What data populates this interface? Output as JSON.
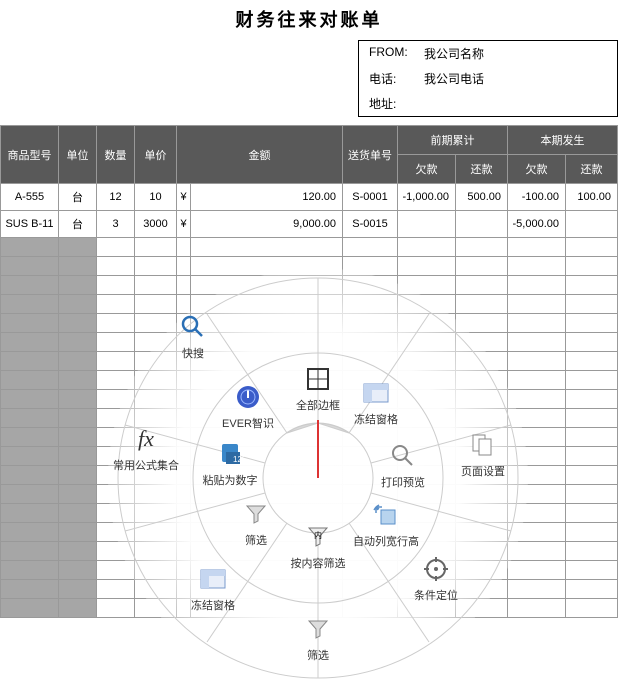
{
  "title": "财务往来对账单",
  "info": {
    "from_label": "FROM:",
    "from_val": "我公司名称",
    "tel_label": "电话:",
    "tel_val": "我公司电话",
    "addr_label": "地址:",
    "addr_val": ""
  },
  "headers": {
    "model": "商品型号",
    "unit": "单位",
    "qty": "数量",
    "price": "单价",
    "amount": "金额",
    "delivery": "送货单号",
    "prev_group": "前期累计",
    "curr_group": "本期发生",
    "prev_debt": "欠款",
    "prev_repay": "还款",
    "curr_debt": "欠款",
    "curr_repay": "还款"
  },
  "rows": [
    {
      "model": "A-555",
      "unit": "台",
      "qty": "12",
      "price": "10",
      "cur": "¥",
      "amount": "120.00",
      "delivery": "S-0001",
      "pd": "-1,000.00",
      "pr": "500.00",
      "cd": "-100.00",
      "cr": "100.00"
    },
    {
      "model": "SUS B-11",
      "unit": "台",
      "qty": "3",
      "price": "3000",
      "cur": "¥",
      "amount": "9,000.00",
      "delivery": "S-0015",
      "pd": "",
      "pr": "",
      "cd": "-5,000.00",
      "cr": ""
    }
  ],
  "radial": {
    "search": "快搜",
    "ever": "EVER智识",
    "border": "全部边框",
    "freeze_r": "冻结窗格",
    "fx": "常用公式集合",
    "paste_num": "粘贴为数字",
    "print": "打印预览",
    "page_setup": "页面设置",
    "filter": "筛选",
    "content_filter": "按内容筛选",
    "autofit": "自动列宽行高",
    "freeze_l": "冻结窗格",
    "locate": "条件定位",
    "filter2": "筛选"
  }
}
